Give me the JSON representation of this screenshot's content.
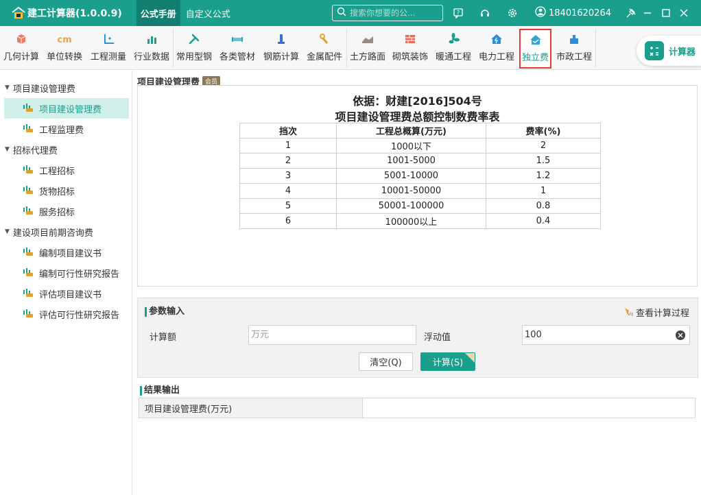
{
  "app": {
    "title": "建工计算器(1.0.0.9)",
    "top_tabs": [
      "公式手册",
      "自定义公式"
    ],
    "search_placeholder": "搜索你想要的公...",
    "user_phone": "18401620264"
  },
  "toolbar": {
    "items": [
      {
        "label": "几何计算",
        "icon": "cube-icon"
      },
      {
        "label": "单位转换",
        "icon": "unit-convert-icon"
      },
      {
        "label": "工程测量",
        "icon": "axis-measure-icon"
      },
      {
        "label": "行业数据",
        "icon": "bar-chart-icon"
      },
      {
        "label": "常用型钢",
        "icon": "wrench-icon"
      },
      {
        "label": "各类管材",
        "icon": "pipe-icon"
      },
      {
        "label": "钢筋计算",
        "icon": "rebar-icon"
      },
      {
        "label": "金属配件",
        "icon": "metal-fitting-icon"
      },
      {
        "label": "土方路面",
        "icon": "earthwork-icon"
      },
      {
        "label": "砌筑装饰",
        "icon": "brick-icon"
      },
      {
        "label": "暖通工程",
        "icon": "fan-icon"
      },
      {
        "label": "电力工程",
        "icon": "electric-house-icon"
      },
      {
        "label": "独立费",
        "icon": "house-icon"
      },
      {
        "label": "市政工程",
        "icon": "municipal-icon"
      }
    ],
    "selected": "独立费",
    "calculator_label": "计算器"
  },
  "sidebar": {
    "groups": [
      {
        "label": "项目建设管理费",
        "items": [
          "项目建设管理费",
          "工程监理费"
        ]
      },
      {
        "label": "招标代理费",
        "items": [
          "工程招标",
          "货物招标",
          "服务招标"
        ]
      },
      {
        "label": "建设项目前期咨询费",
        "items": [
          "编制项目建议书",
          "编制可行性研究报告",
          "评估项目建议书",
          "评估可行性研究报告"
        ]
      }
    ],
    "active_item": "项目建设管理费"
  },
  "main": {
    "section_title": "项目建设管理费",
    "vip_badge": "会员",
    "basis_heading": "依据：财建[2016]504号",
    "table_heading": "项目建设管理费总额控制数费率表",
    "table": {
      "headers": [
        "挡次",
        "工程总概算(万元)",
        "费率(%)"
      ],
      "rows": [
        [
          "1",
          "1000以下",
          "2"
        ],
        [
          "2",
          "1001-5000",
          "1.5"
        ],
        [
          "3",
          "5001-10000",
          "1.2"
        ],
        [
          "4",
          "10001-50000",
          "1"
        ],
        [
          "5",
          "50001-100000",
          "0.8"
        ],
        [
          "6",
          "100000以上",
          "0.4"
        ]
      ]
    }
  },
  "params": {
    "title": "参数输入",
    "view_process": "查看计算过程",
    "amount_label": "计算额",
    "amount_placeholder": "万元",
    "float_label": "浮动值",
    "float_value": "100",
    "clear_button": "清空(Q)",
    "calc_button": "计算(S)"
  },
  "results": {
    "title": "结果输出",
    "rows": [
      {
        "label": "项目建设管理费(万元)",
        "value": ""
      }
    ]
  },
  "colors": {
    "primary": "#1a9f8c",
    "active_bg": "#d3efe9",
    "highlight_border": "#e53935"
  }
}
